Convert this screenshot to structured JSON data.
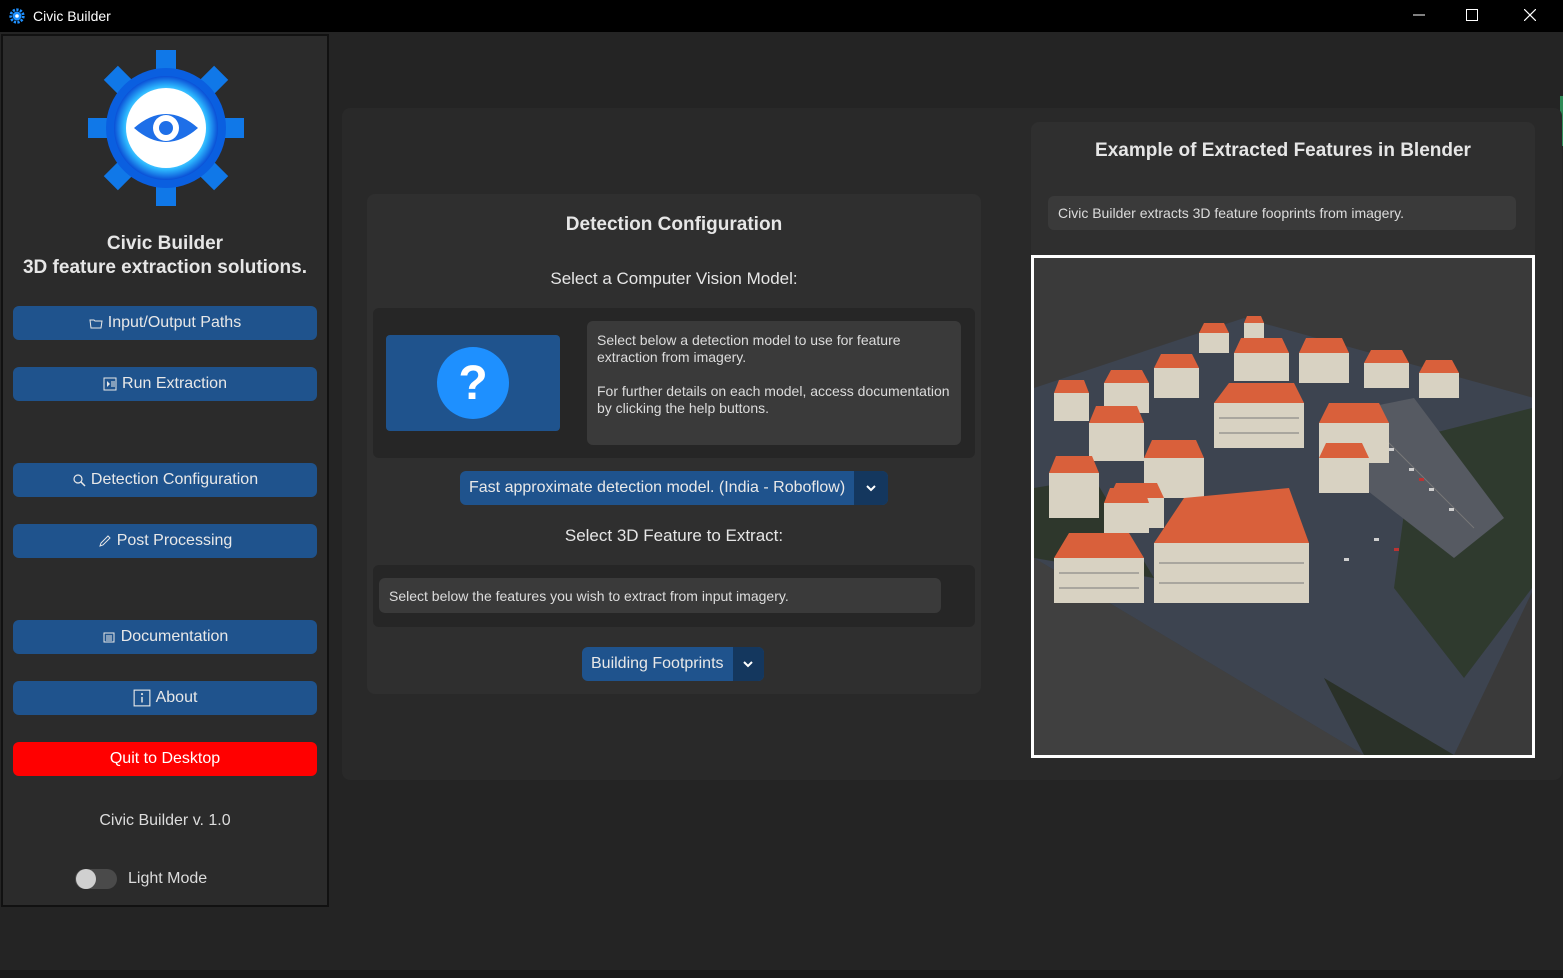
{
  "window": {
    "title": "Civic Builder"
  },
  "sidebar": {
    "brand_line1": "Civic Builder",
    "brand_line2": "3D feature extraction solutions.",
    "buttons": [
      {
        "label": "Input/Output Paths",
        "icon": "folder-icon"
      },
      {
        "label": "Run Extraction",
        "icon": "play-pause-icon"
      },
      {
        "label": "Detection Configuration",
        "icon": "magnifier-icon"
      },
      {
        "label": "Post Processing",
        "icon": "pencil-icon"
      },
      {
        "label": "Documentation",
        "icon": "document-icon"
      },
      {
        "label": "About",
        "icon": "info-icon"
      }
    ],
    "quit_label": "Quit to Desktop",
    "version": "Civic Builder v. 1.0",
    "theme_toggle_label": "Light Mode",
    "theme_toggle_on": false
  },
  "config": {
    "title": "Detection Configuration",
    "model_heading": "Select a Computer Vision Model:",
    "model_desc_1": "Select below a detection model to use for feature extraction from imagery.",
    "model_desc_2": "For further details on each model, access documentation by clicking the help buttons.",
    "help_icon": "question-mark-icon",
    "model_selected": "Fast approximate detection model. (India - Roboflow)",
    "feature_heading": "Select 3D Feature to Extract:",
    "feature_desc": "Select below the features you wish to extract from input imagery.",
    "feature_selected": "Building Footprints"
  },
  "example": {
    "title": "Example of Extracted Features in Blender",
    "description": "Civic Builder extracts 3D feature fooprints from imagery."
  },
  "colors": {
    "accent": "#1f538d",
    "accent_dark": "#14375e",
    "quit": "#ff0000",
    "background": "#242424",
    "roof": "#d9603b"
  }
}
